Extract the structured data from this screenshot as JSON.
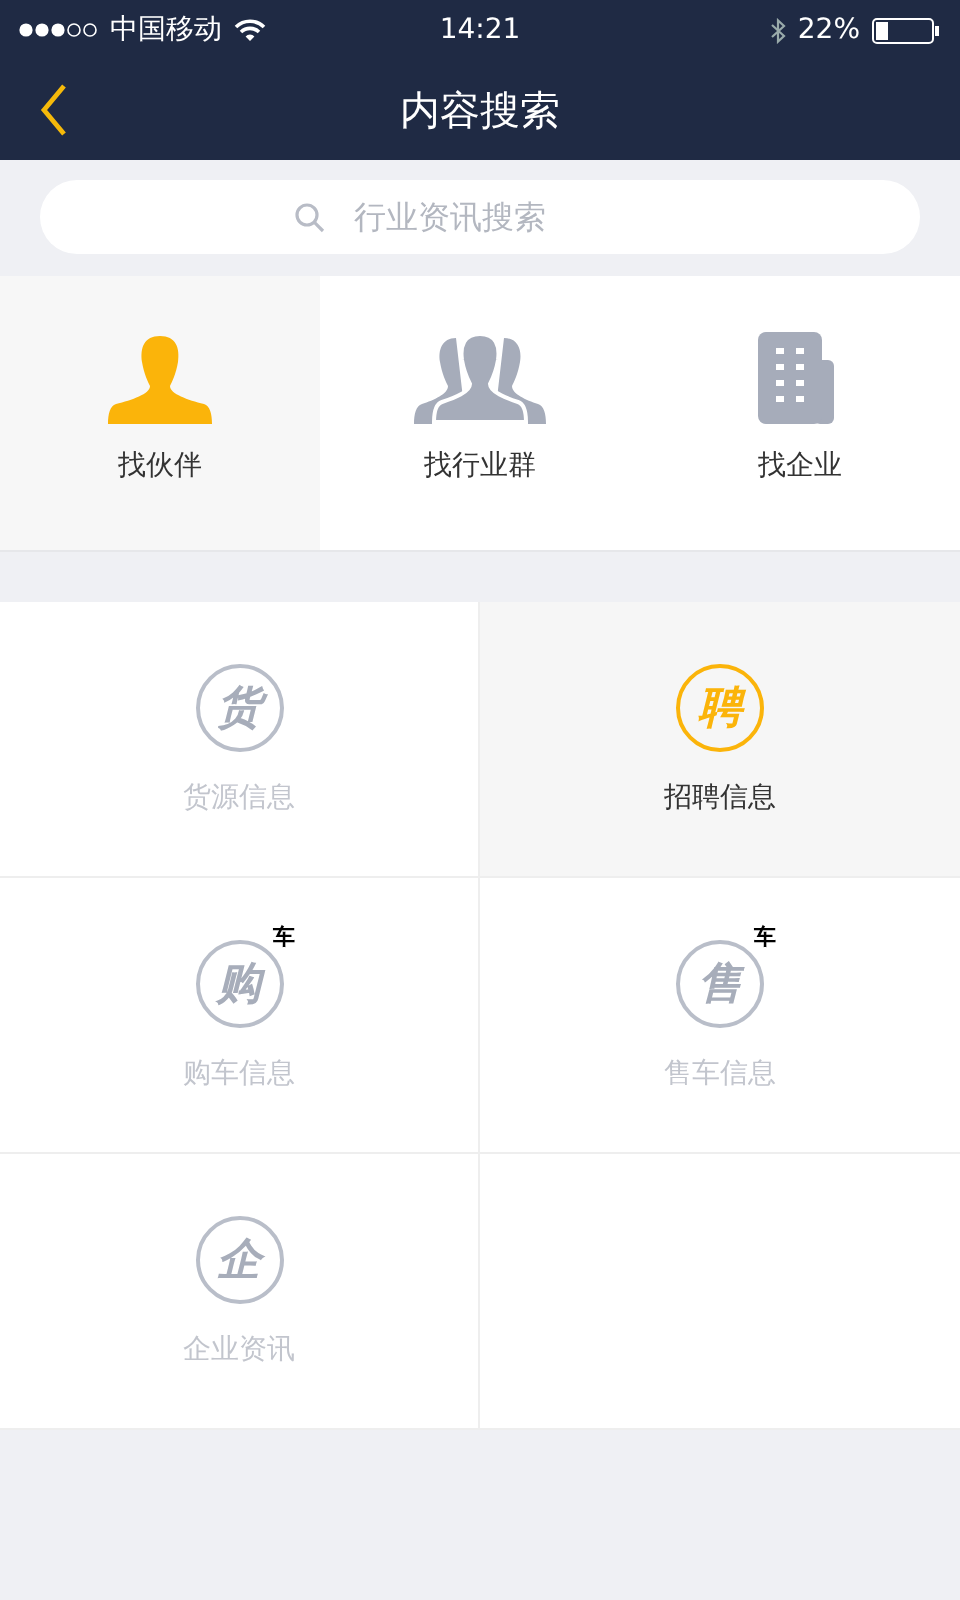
{
  "status_bar": {
    "carrier": "中国移动",
    "time": "14:21",
    "battery": "22%"
  },
  "nav": {
    "title": "内容搜索"
  },
  "search": {
    "placeholder": "行业资讯搜索"
  },
  "finders": [
    {
      "label": "找伙伴",
      "kind": "person",
      "selected": true
    },
    {
      "label": "找行业群",
      "kind": "group",
      "selected": false
    },
    {
      "label": "找企业",
      "kind": "building",
      "selected": false
    }
  ],
  "categories": [
    {
      "label": "货源信息",
      "glyph": "货",
      "selected": false
    },
    {
      "label": "招聘信息",
      "glyph": "聘",
      "selected": true
    },
    {
      "label": "购车信息",
      "glyph": "购",
      "sup": "车",
      "selected": false
    },
    {
      "label": "售车信息",
      "glyph": "售",
      "sup": "车",
      "selected": false
    },
    {
      "label": "企业资讯",
      "glyph": "企",
      "selected": false
    }
  ]
}
